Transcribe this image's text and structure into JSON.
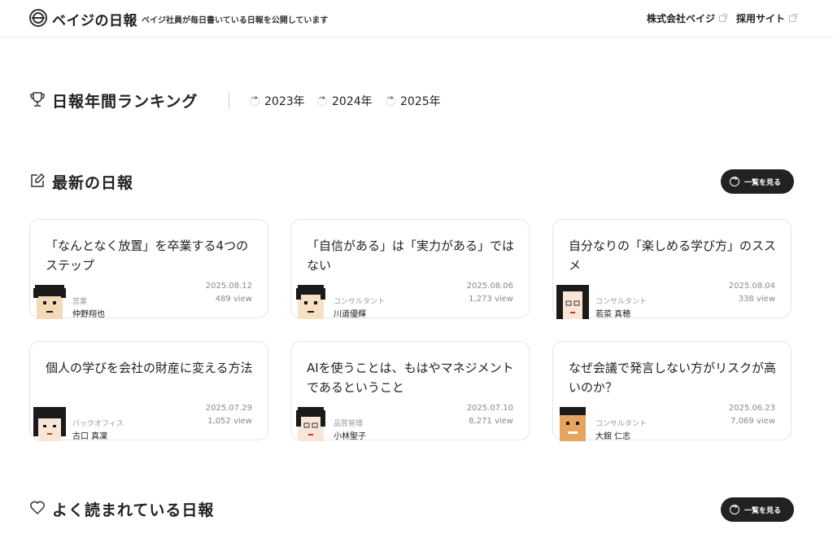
{
  "header": {
    "site_title": "ベイジの日報",
    "tagline": "ベイジ社員が毎日書いている日報を公開しています",
    "links": [
      {
        "label": "株式会社ベイジ",
        "icon": "external-link-icon"
      },
      {
        "label": "採用サイト",
        "icon": "external-link-icon"
      }
    ]
  },
  "ranking": {
    "title": "日報年間ランキング",
    "icon": "trophy-icon",
    "years": [
      "2023年",
      "2024年",
      "2025年"
    ]
  },
  "latest": {
    "title": "最新の日報",
    "icon": "edit-icon",
    "button_label": "一覧を見る",
    "cards": [
      {
        "title": "「なんとなく放置」を卒業する4つのステップ",
        "date": "2025.08.12",
        "views": "489 view",
        "role": "営業",
        "author": "仲野翔也"
      },
      {
        "title": "「自信がある」は「実力がある」ではない",
        "date": "2025.08.06",
        "views": "1,273 view",
        "role": "コンサルタント",
        "author": "川道優輝"
      },
      {
        "title": "自分なりの「楽しめる学び方」のススメ",
        "date": "2025.08.04",
        "views": "338 view",
        "role": "コンサルタント",
        "author": "若菜 真穂"
      },
      {
        "title": "個人の学びを会社の財産に変える方法",
        "date": "2025.07.29",
        "views": "1,052 view",
        "role": "バックオフィス",
        "author": "古口 真凜"
      },
      {
        "title": "AIを使うことは、もはやマネジメントであるということ",
        "date": "2025.07.10",
        "views": "8,271 view",
        "role": "品質管理",
        "author": "小林聖子"
      },
      {
        "title": "なぜ会議で発言しない方がリスクが高いのか？",
        "date": "2025.06.23",
        "views": "7,069 view",
        "role": "コンサルタント",
        "author": "大舘 仁志"
      }
    ]
  },
  "popular": {
    "title": "よく読まれている日報",
    "icon": "heart-icon",
    "button_label": "一覧を見る"
  },
  "colors": {
    "text": "#222222",
    "button_bg": "#222222",
    "meta": "#888888",
    "border": "#e6e6e6"
  }
}
